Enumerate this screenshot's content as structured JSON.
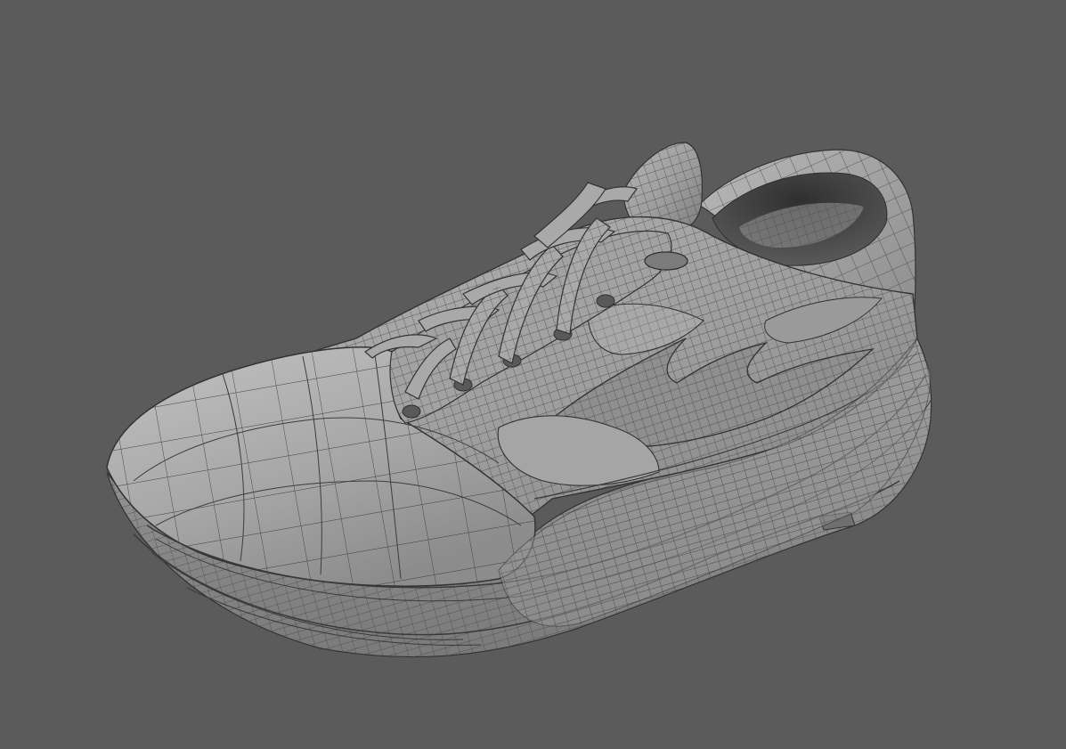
{
  "viewport": {
    "background_color": "#5b5b5b",
    "subject": "sneaker-wireframe-render",
    "shading": "smooth-gray-with-wireframe-overlay",
    "model_color": "#9c9c9c",
    "wire_color": "#3c3c3c"
  }
}
